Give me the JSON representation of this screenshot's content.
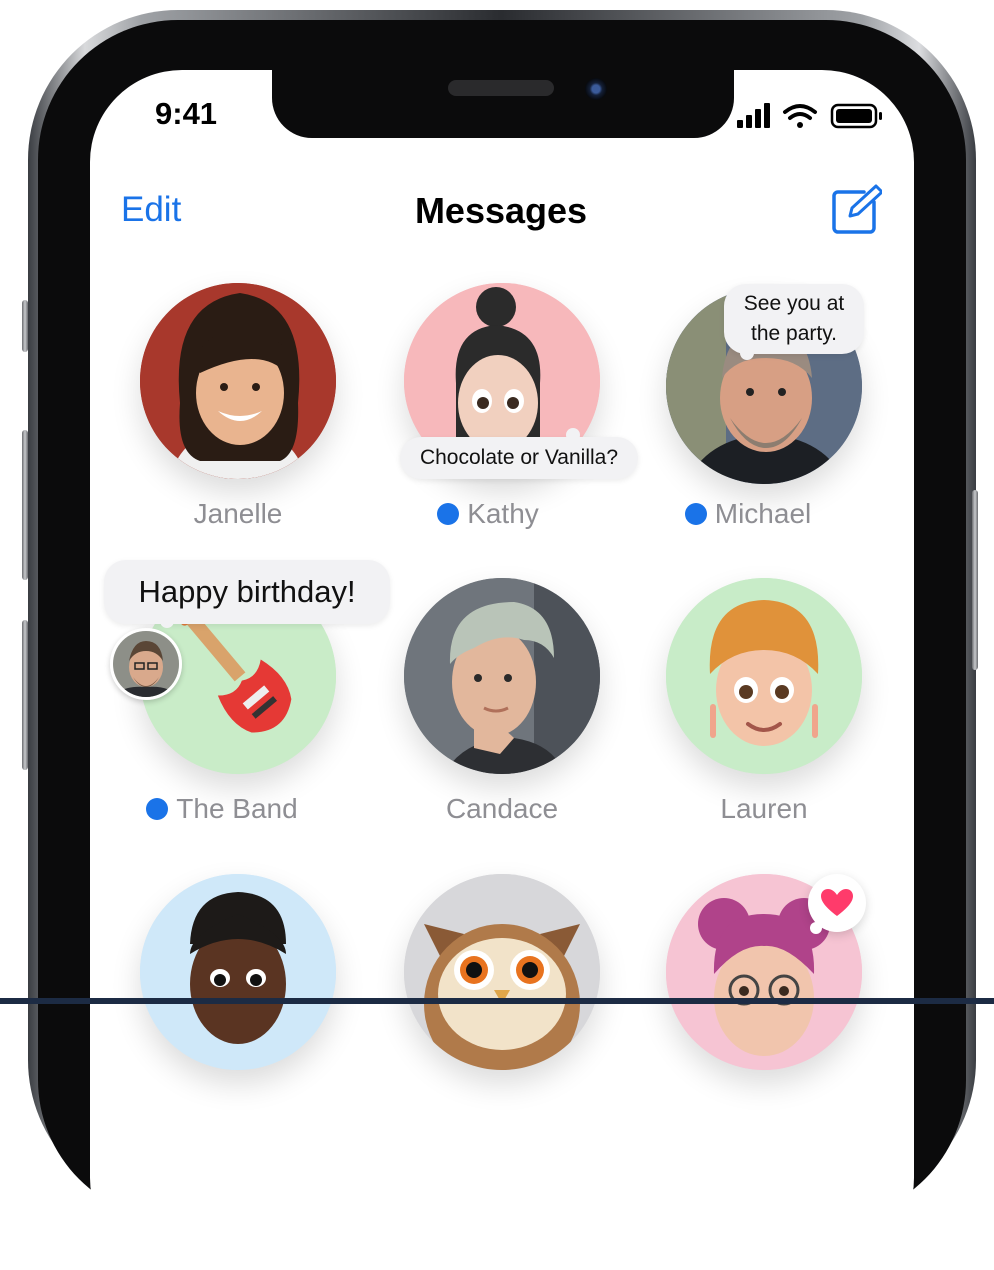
{
  "status_bar": {
    "time": "9:41"
  },
  "nav": {
    "edit_label": "Edit",
    "title": "Messages",
    "compose_icon": "compose-icon"
  },
  "colors": {
    "accent": "#1a73e8",
    "name_gray": "#8e8e93",
    "bubble_bg": "#f2f2f4",
    "heart": "#ff3b6b"
  },
  "pinned": [
    {
      "name": "Janelle",
      "unread": false,
      "bg": "#a8382c"
    },
    {
      "name": "Kathy",
      "unread": true,
      "bg": "#f7b8bb",
      "bubble": "Chocolate or Vanilla?"
    },
    {
      "name": "Michael",
      "unread": true,
      "bg": "#6a7a90",
      "bubble_line1": "See you at",
      "bubble_line2": "the party."
    },
    {
      "name": "The Band",
      "unread": true,
      "bg": "#c9ecc8",
      "bubble": "Happy birthday!"
    },
    {
      "name": "Candace",
      "unread": false,
      "bg": "#7a7f86"
    },
    {
      "name": "Lauren",
      "unread": false,
      "bg": "#c8ecc8"
    }
  ]
}
